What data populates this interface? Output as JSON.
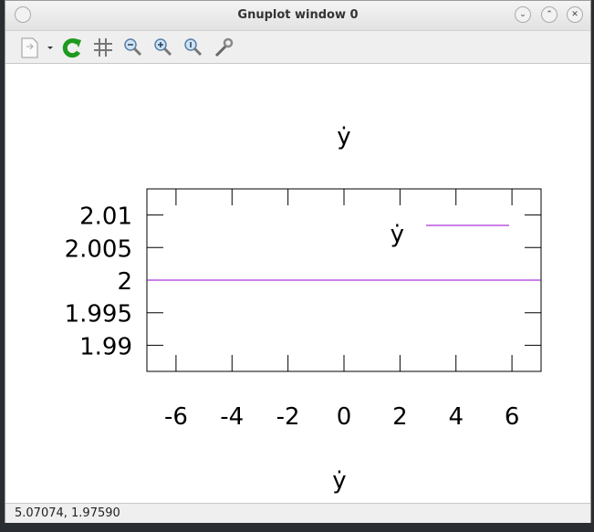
{
  "window": {
    "title": "Gnuplot window 0"
  },
  "toolbar": {
    "items": [
      "export-icon",
      "replot-icon",
      "grid-icon",
      "zoom-out-icon",
      "zoom-in-icon",
      "zoom-reset-icon",
      "settings-icon"
    ]
  },
  "status": {
    "coords": "5.07074, 1.97590"
  },
  "chart_data": {
    "type": "line",
    "title": "ẏ",
    "xlabel": "ẏ",
    "ylabel": "",
    "xlim": [
      -7.04,
      7.04
    ],
    "ylim": [
      1.986,
      2.014
    ],
    "xticks": [
      -6,
      -4,
      -2,
      0,
      2,
      4,
      6
    ],
    "xtick_labels": [
      "-6",
      "-4",
      "-2",
      "0",
      "2",
      "4",
      "6"
    ],
    "yticks": [
      2.01,
      2.005,
      2,
      1.995,
      1.99
    ],
    "ytick_labels": [
      "2.01",
      "2.005",
      "2",
      "1.995",
      "1.99"
    ],
    "grid": false,
    "legend": {
      "position": "top-right",
      "entries": [
        "ẏ"
      ]
    },
    "series": [
      {
        "name": "ẏ",
        "color": "#9400d3",
        "x": [
          -7.04,
          7.04
        ],
        "y": [
          2,
          2
        ]
      }
    ]
  }
}
